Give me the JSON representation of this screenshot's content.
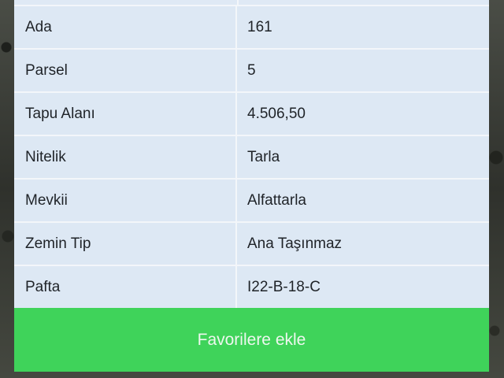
{
  "table": {
    "rows": [
      {
        "label": "Ada",
        "value": "161"
      },
      {
        "label": "Parsel",
        "value": "5"
      },
      {
        "label": "Tapu Alanı",
        "value": "4.506,50"
      },
      {
        "label": "Nitelik",
        "value": "Tarla"
      },
      {
        "label": "Mevkii",
        "value": "Alfattarla"
      },
      {
        "label": "Zemin Tip",
        "value": "Ana Taşınmaz"
      },
      {
        "label": "Pafta",
        "value": "I22-B-18-C"
      }
    ]
  },
  "actions": {
    "favorite_label": "Favorilere ekle"
  },
  "colors": {
    "table_bg": "#dde8f4",
    "button_bg": "#3fd35a",
    "button_text": "#eef7ef"
  }
}
